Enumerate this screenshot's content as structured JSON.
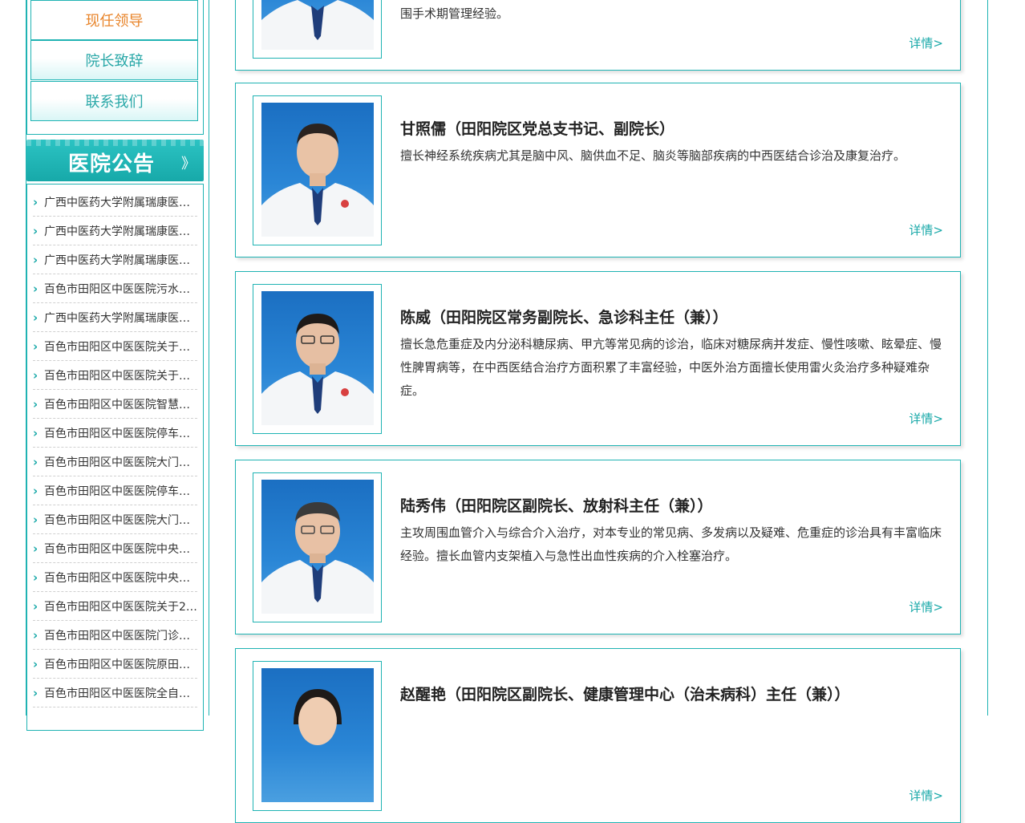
{
  "nav": {
    "items": [
      {
        "label": "现任领导",
        "active": true
      },
      {
        "label": "院长致辞",
        "active": false
      },
      {
        "label": "联系我们",
        "active": false
      }
    ]
  },
  "notices": {
    "title": "医院公告",
    "arrow": "》",
    "items": [
      "广西中医药大学附属瑞康医…",
      "广西中医药大学附属瑞康医…",
      "广西中医药大学附属瑞康医…",
      "百色市田阳区中医医院污水…",
      "广西中医药大学附属瑞康医…",
      "百色市田阳区中医医院关于…",
      "百色市田阳区中医医院关于…",
      "百色市田阳区中医医院智慧…",
      "百色市田阳区中医医院停车…",
      "百色市田阳区中医医院大门…",
      "百色市田阳区中医医院停车…",
      "百色市田阳区中医医院大门…",
      "百色市田阳区中医医院中央…",
      "百色市田阳区中医医院中央…",
      "百色市田阳区中医医院关于2…",
      "百色市田阳区中医医院门诊…",
      "百色市田阳区中医医院原田…",
      "百色市田阳区中医医院全自…"
    ]
  },
  "leaders": [
    {
      "name": "",
      "desc": "围手术期管理经验。",
      "detail": "详情>"
    },
    {
      "name": "甘照儒（田阳院区党总支书记、副院长）",
      "desc": "擅长神经系统疾病尤其是脑中风、脑供血不足、脑炎等脑部疾病的中西医结合诊治及康复治疗。",
      "detail": "详情>"
    },
    {
      "name": "陈威（田阳院区常务副院长、急诊科主任（兼））",
      "desc": "擅长急危重症及内分泌科糖尿病、甲亢等常见病的诊治，临床对糖尿病并发症、慢性咳嗽、眩晕症、慢性脾胃病等，在中西医结合治疗方面积累了丰富经验，中医外治方面擅长使用雷火灸治疗多种疑难杂症。",
      "detail": "详情>"
    },
    {
      "name": "陆秀伟（田阳院区副院长、放射科主任（兼））",
      "desc": "主攻周围血管介入与综合介入治疗，对本专业的常见病、多发病以及疑难、危重症的诊治具有丰富临床经验。擅长血管内支架植入与急性出血性疾病的介入栓塞治疗。",
      "detail": "详情>"
    },
    {
      "name": "赵醒艳（田阳院区副院长、健康管理中心（治未病科）主任（兼））",
      "desc": "",
      "detail": "详情>"
    }
  ]
}
